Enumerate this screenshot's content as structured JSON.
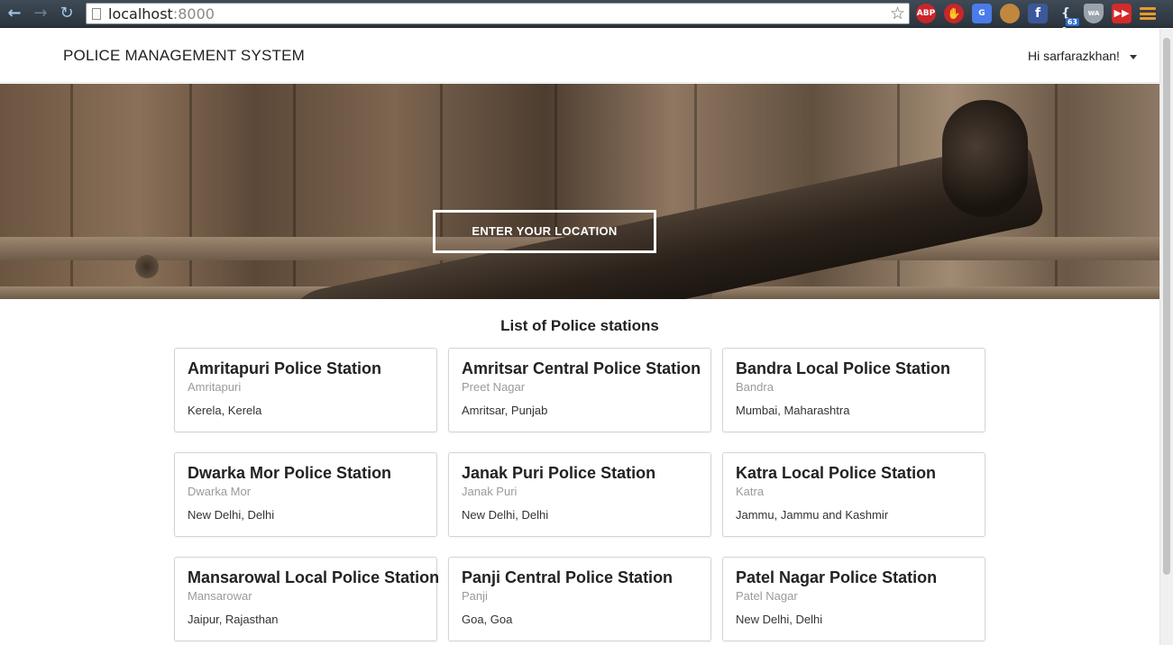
{
  "browser": {
    "url_host": "localhost",
    "url_port": ":8000",
    "extensions": [
      {
        "name": "abp-icon",
        "label": "ABP"
      },
      {
        "name": "stop-icon",
        "label": "✋"
      },
      {
        "name": "translate-icon",
        "label": "G"
      },
      {
        "name": "cookie-icon",
        "label": ""
      },
      {
        "name": "facebook-icon",
        "label": "f"
      },
      {
        "name": "brackets-icon",
        "label": "{ }",
        "badge": "63"
      },
      {
        "name": "shield-icon",
        "label": "WA"
      },
      {
        "name": "fast-forward-icon",
        "label": "▶▶"
      }
    ]
  },
  "navbar": {
    "brand": "POLICE MANAGEMENT SYSTEM",
    "user_greeting": "Hi sarfarazkhan!"
  },
  "hero": {
    "button_label": "ENTER YOUR LOCATION"
  },
  "stations": {
    "heading": "List of Police stations",
    "items": [
      {
        "name": "Amritapuri Police Station",
        "area": "Amritapuri",
        "location": "Kerela, Kerela"
      },
      {
        "name": "Amritsar Central Police Station",
        "area": "Preet Nagar",
        "location": "Amritsar, Punjab"
      },
      {
        "name": "Bandra Local Police Station",
        "area": "Bandra",
        "location": "Mumbai, Maharashtra"
      },
      {
        "name": "Dwarka Mor Police Station",
        "area": "Dwarka Mor",
        "location": "New Delhi, Delhi"
      },
      {
        "name": "Janak Puri Police Station",
        "area": "Janak Puri",
        "location": "New Delhi, Delhi"
      },
      {
        "name": "Katra Local Police Station",
        "area": "Katra",
        "location": "Jammu, Jammu and Kashmir"
      },
      {
        "name": "Mansarowal Local Police Station",
        "area": "Mansarowar",
        "location": "Jaipur, Rajasthan"
      },
      {
        "name": "Panji Central Police Station",
        "area": "Panji",
        "location": "Goa, Goa"
      },
      {
        "name": "Patel Nagar Police Station",
        "area": "Patel Nagar",
        "location": "New Delhi, Delhi"
      }
    ]
  }
}
